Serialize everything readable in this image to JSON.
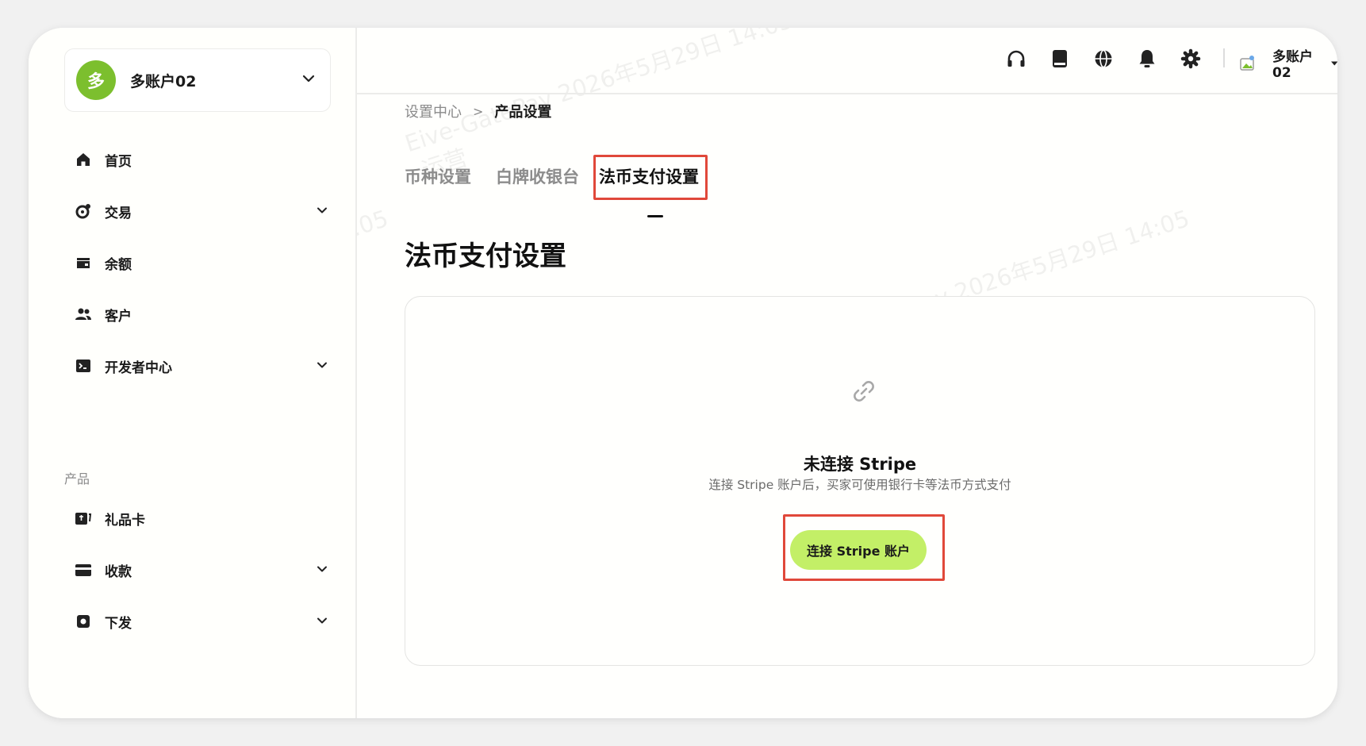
{
  "account": {
    "avatar_char": "多",
    "name": "多账户02"
  },
  "sidebar": {
    "items": [
      {
        "label": "首页",
        "icon": "home-icon",
        "expandable": false
      },
      {
        "label": "交易",
        "icon": "transaction-icon",
        "expandable": true
      },
      {
        "label": "余额",
        "icon": "wallet-icon",
        "expandable": false
      },
      {
        "label": "客户",
        "icon": "users-icon",
        "expandable": false
      },
      {
        "label": "开发者中心",
        "icon": "terminal-icon",
        "expandable": true
      }
    ],
    "section_label": "产品",
    "product_items": [
      {
        "label": "礼品卡",
        "icon": "gift-card-icon",
        "expandable": false
      },
      {
        "label": "收款",
        "icon": "card-icon",
        "expandable": true
      },
      {
        "label": "下发",
        "icon": "payout-icon",
        "expandable": true
      }
    ]
  },
  "topbar": {
    "icons": [
      "headset-icon",
      "book-icon",
      "globe-icon",
      "bell-icon",
      "gear-icon"
    ],
    "user_name": "多账户02"
  },
  "breadcrumb": {
    "parent": "设置中心",
    "separator": ">",
    "current": "产品设置"
  },
  "tabs": [
    {
      "label": "币种设置",
      "active": false
    },
    {
      "label": "白牌收银台",
      "active": false
    },
    {
      "label": "法币支付设置",
      "active": true
    }
  ],
  "page_title": "法币支付设置",
  "empty_state": {
    "icon": "link-icon",
    "title": "未连接 Stripe",
    "description": "连接 Stripe 账户后，买家可使用银行卡等法币方式支付",
    "button_label": "连接 Stripe 账户"
  },
  "watermark": {
    "line1": "Eive-GatePay 2026年5月29日 14:05",
    "line2": "运营"
  },
  "colors": {
    "accent": "#c3ef67",
    "avatar": "#7cbf2e",
    "highlight": "#e0483a"
  }
}
